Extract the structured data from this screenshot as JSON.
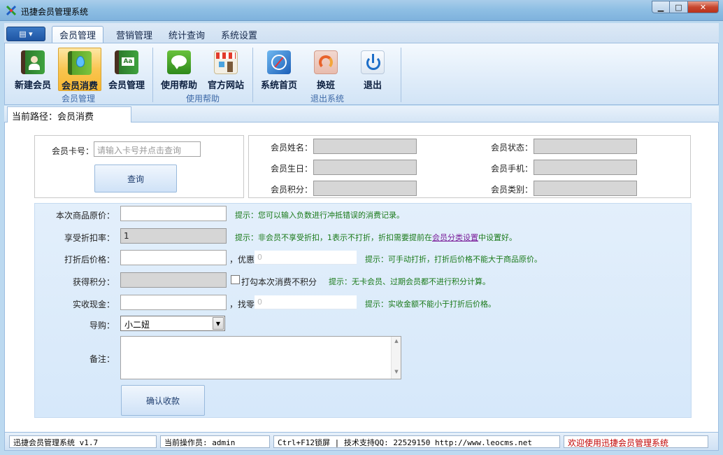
{
  "window": {
    "title": "迅捷会员管理系统",
    "min_glyph": "▁",
    "max_glyph": "□",
    "close_glyph": "✕"
  },
  "ribbon": {
    "menu_glyph": "▤ ▾",
    "tabs": [
      {
        "label": "会员管理"
      },
      {
        "label": "营销管理"
      },
      {
        "label": "统计查询"
      },
      {
        "label": "系统设置"
      }
    ],
    "groups": [
      {
        "label": "会员管理"
      },
      {
        "label": "使用帮助"
      },
      {
        "label": "退出系统"
      }
    ],
    "buttons": [
      {
        "label": "新建会员",
        "icon": "member-book-icon"
      },
      {
        "label": "会员消费",
        "icon": "water-drop-icon"
      },
      {
        "label": "会员管理",
        "icon": "address-book-icon"
      },
      {
        "label": "使用帮助",
        "icon": "speech-bubble-icon"
      },
      {
        "label": "官方网站",
        "icon": "shop-icon"
      },
      {
        "label": "系统首页",
        "icon": "compass-icon"
      },
      {
        "label": "换班",
        "icon": "swap-icon"
      },
      {
        "label": "退出",
        "icon": "power-icon"
      }
    ]
  },
  "breadcrumb": {
    "text": "当前路径：会员消费"
  },
  "search": {
    "card_label": "会员卡号：",
    "card_placeholder": "请输入卡号并点击查询",
    "query_button": "查询"
  },
  "member_info": {
    "name_label": "会员姓名：",
    "birthday_label": "会员生日：",
    "points_label": "会员积分：",
    "status_label": "会员状态：",
    "phone_label": "会员手机：",
    "category_label": "会员类别："
  },
  "form": {
    "original_price_label": "本次商品原价：",
    "original_price_hint": "提示：您可以输入负数进行冲抵错误的消费记录。",
    "discount_label": "享受折扣率：",
    "discount_value": "1",
    "discount_hint_before": "提示：非会员不享受折扣，1表示不打折，折扣需要提前在",
    "discount_hint_link": "会员分类设置",
    "discount_hint_after": "中设置好。",
    "after_price_label": "打折后价格：",
    "concession_label": "，优惠",
    "concession_value": "0",
    "after_price_hint": "提示：可手动打折，打折后价格不能大于商品原价。",
    "points_label": "获得积分：",
    "no_points_label": "打勾本次消费不积分",
    "points_hint": "提示：无卡会员、过期会员都不进行积分计算。",
    "cash_label": "实收现金：",
    "change_label": "，找零",
    "change_value": "0",
    "cash_hint": "提示：实收金额不能小于打折后价格。",
    "guide_label": "导购：",
    "guide_value": "小二妞",
    "remark_label": "备注：",
    "confirm_button": "确认收款"
  },
  "statusbar": {
    "version": "迅捷会员管理系统 v1.7",
    "operator": "当前操作员: admin",
    "support": "Ctrl+F12锁屏 | 技术支持QQ:  22529150        http://www.leocms.net",
    "welcome": "欢迎使用迅捷会员管理系统"
  },
  "colors": {
    "accent": "#3e6aa8",
    "hint_green": "#1a7a1a",
    "active_button": "#f9c550",
    "welcome_red": "#c00000"
  }
}
